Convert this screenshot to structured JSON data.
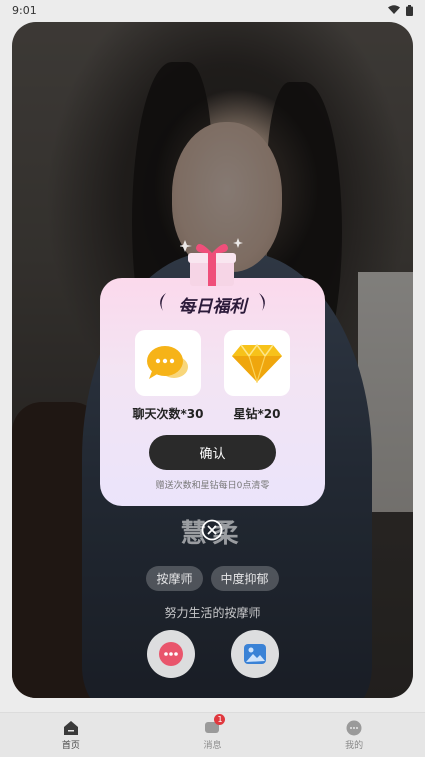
{
  "status_bar": {
    "time": "9:01"
  },
  "profile": {
    "name": "慧柔",
    "tags": [
      "按摩师",
      "中度抑郁"
    ],
    "bio": "努力生活的按摩师"
  },
  "modal": {
    "title": "每日福利",
    "rewards": [
      {
        "label": "聊天次数*30",
        "icon": "chat-bubble-icon"
      },
      {
        "label": "星钻*20",
        "icon": "diamond-icon"
      }
    ],
    "confirm_label": "确认",
    "note": "赠送次数和星钻每日0点清零"
  },
  "tab_bar": {
    "items": [
      {
        "label": "首页",
        "active": true
      },
      {
        "label": "消息",
        "badge": "1"
      },
      {
        "label": "我的"
      }
    ]
  },
  "colors": {
    "confirm": "#2a2a2a",
    "badge": "#e0383e",
    "modal_top": "#fbd9ec",
    "modal_bottom": "#ebe4fb"
  }
}
